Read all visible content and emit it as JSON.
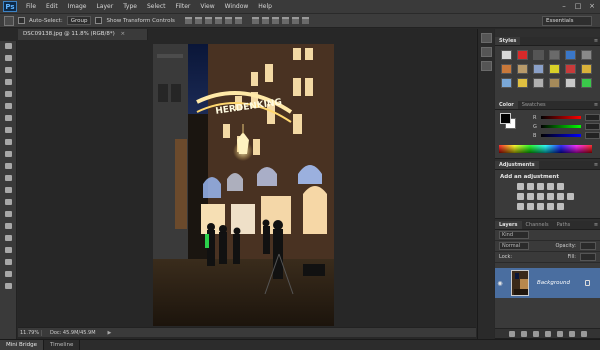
{
  "menu": {
    "logo": "Ps",
    "items": [
      "File",
      "Edit",
      "Image",
      "Layer",
      "Type",
      "Select",
      "Filter",
      "View",
      "Window",
      "Help"
    ]
  },
  "options": {
    "auto_select_label": "Auto-Select:",
    "auto_select_value": "Group",
    "transform_label": "Show Transform Controls",
    "workspace": "Essentials"
  },
  "document": {
    "tab_title": "DSC09138.jpg @ 11.8% (RGB/8*)",
    "close": "×",
    "zoom": "11.79%",
    "doc_info": "Doc: 45.9M/45.9M"
  },
  "bottom_tabs": [
    "Mini Bridge",
    "Timeline"
  ],
  "panels": {
    "styles_tab": "Styles",
    "color_tabs": [
      "Color",
      "Swatches"
    ],
    "color_channels": [
      "R",
      "G",
      "B"
    ],
    "adjustments_tab": "Adjustments",
    "adjustments_title": "Add an adjustment",
    "layers_tabs": [
      "Layers",
      "Channels",
      "Paths"
    ],
    "layers_kind": "Kind",
    "blend_mode": "Normal",
    "opacity_label": "Opacity:",
    "lock_label": "Lock:",
    "fill_label": "Fill:",
    "layer_name": "Background"
  },
  "colors": {
    "accent_selected": "#4a6ea0",
    "style_swatches": [
      "#d9d9d9",
      "#d82a2a",
      "#555555",
      "#6a6a6a",
      "#3a77c8",
      "#8a8a8a",
      "#c8783a",
      "#b89a6a",
      "#8aa0c8",
      "#d8d028",
      "#c83a3a",
      "#d9b23a",
      "#7aa8d8",
      "#e0c040",
      "#b0b0b0",
      "#a58a5a",
      "#c8c8c8",
      "#3ac84a"
    ]
  },
  "canvas_signage": "HERDENKING"
}
